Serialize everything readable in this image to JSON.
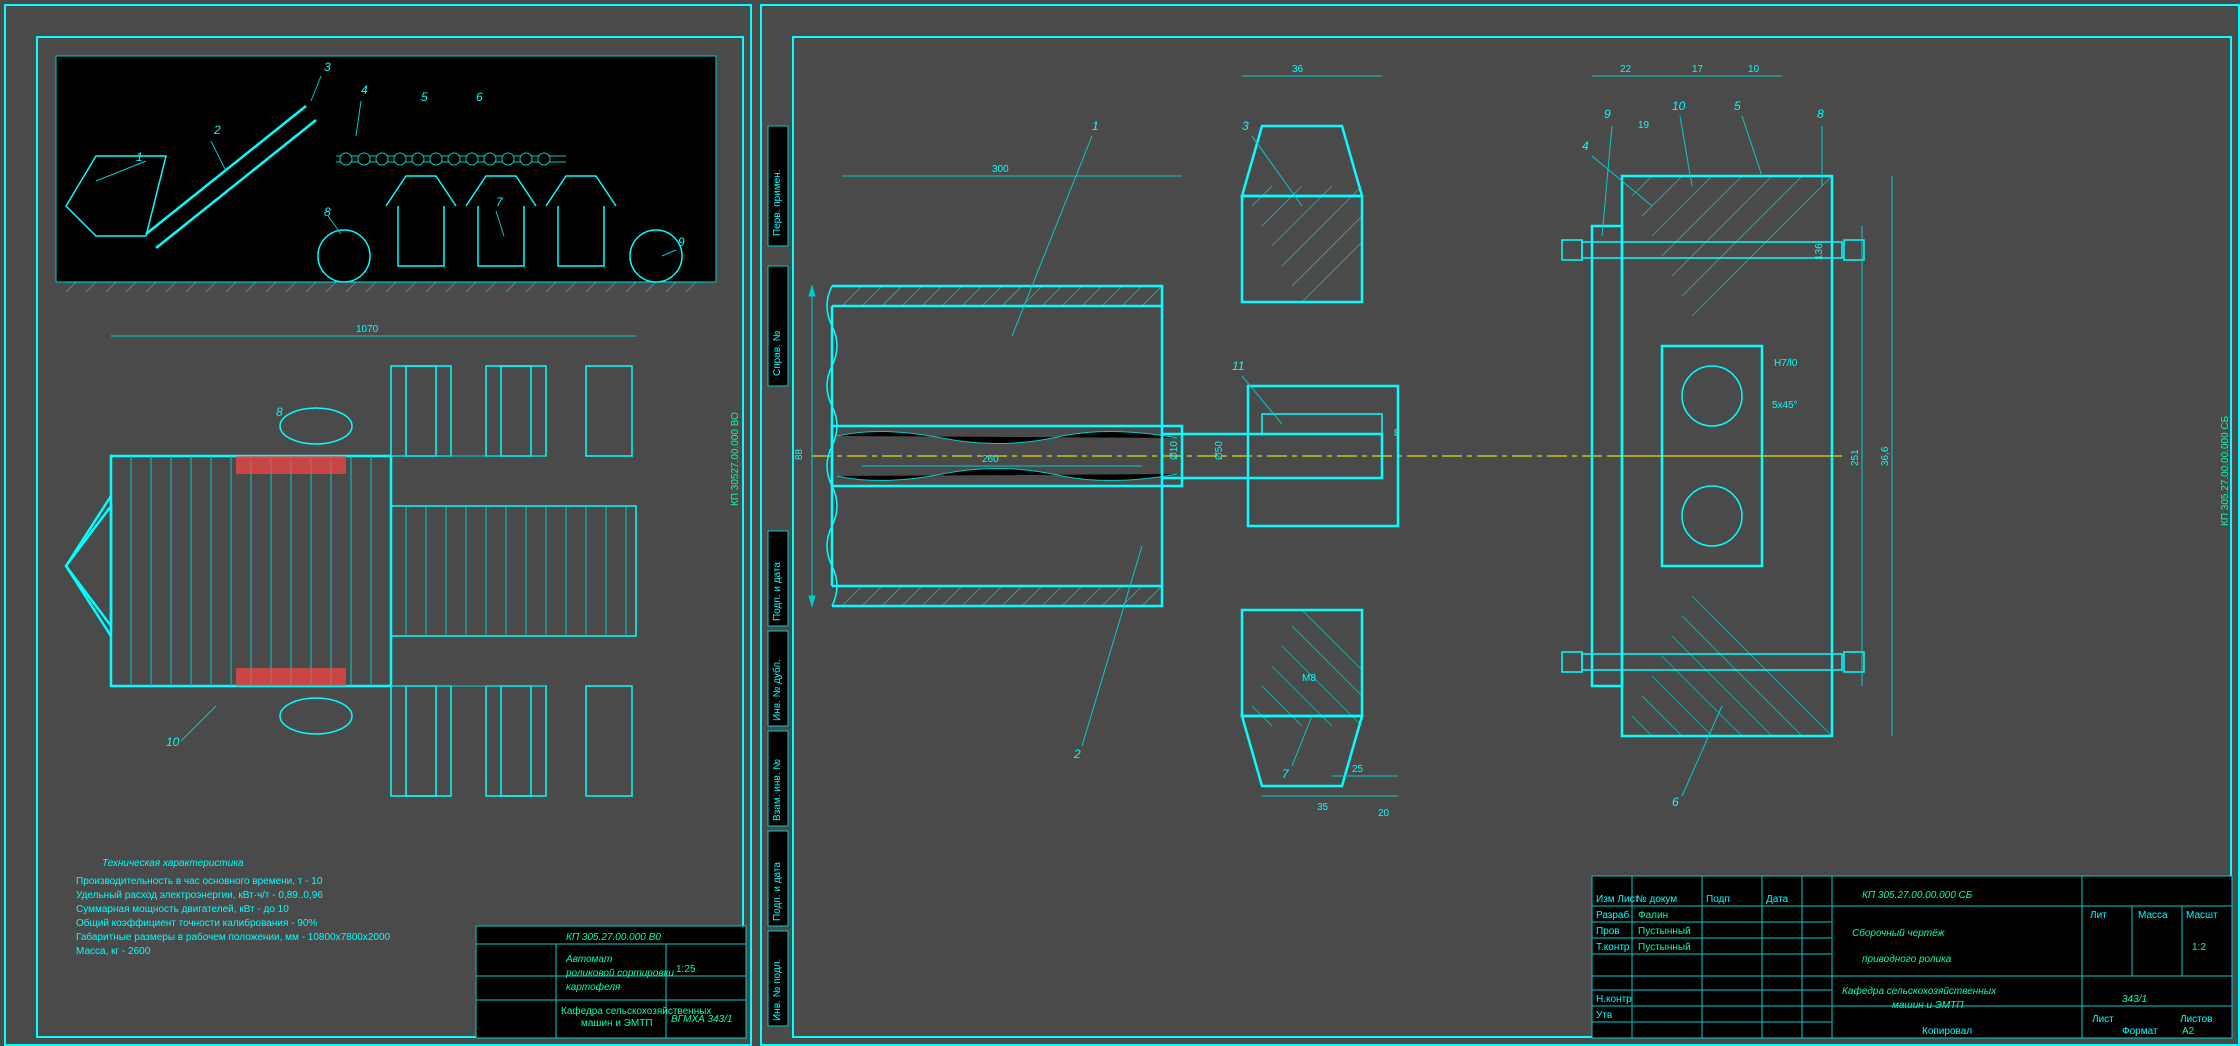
{
  "left": {
    "code": "КП 305.27.00.000 В0",
    "side_code": "КП 30527.00.000 ВО",
    "title_main": "Автомат",
    "title_sub1": "роликовой сортировки",
    "title_sub2": "картофеля",
    "university": "ВГМХА 343/1",
    "dept": "Кафедра сельскохозяйственных",
    "dept2": "машин и ЭМТП",
    "scale": "1:25",
    "tech": {
      "h": "Техническая характеристика",
      "l1": "Производительность в час основного времени, т - 10",
      "l2": "Удельный расход электроэнергии, кВт·ч/т - 0,89..0,96",
      "l3": "Суммарная мощность двигателей, кВт - до 10",
      "l4": "Общий коэффициент точности калибрования - 90%",
      "l5": "Габаритные размеры в рабочем положении, мм - 10800x7800x2000",
      "l6": "Масса, кг - 2600"
    },
    "parts": [
      "1",
      "2",
      "3",
      "4",
      "5",
      "6",
      "7",
      "8",
      "9",
      "10"
    ],
    "dims": {
      "top_len": "1070",
      "plan_len": "1070"
    }
  },
  "right": {
    "code": "КП 305.27.00.00.000 СБ",
    "side_code": "КП 305.27.00.00.000 СБ",
    "title1": "Сборочный чертёж",
    "title2": "приводного ролика",
    "dept": "Кафедра сельскохозяйственных",
    "dept2": "машин и ЭМТП",
    "group": "343/1",
    "scale": "1:2",
    "format": "А2",
    "parts": [
      "1",
      "2",
      "3",
      "4",
      "5",
      "6",
      "7",
      "8",
      "9",
      "10",
      "11"
    ],
    "dims": {
      "d_main": "88",
      "len1": "300",
      "len2": "260",
      "shaft_d": "Ø10",
      "hub_w": "36",
      "key_w": "M8",
      "hub_d": "Ø50",
      "key_f": "8",
      "small": "10",
      "gap25": "25",
      "gap35": "35",
      "gap20": "20",
      "flg22": "22",
      "flg17": "17",
      "flg10": "10",
      "btot": "36,6",
      "bseat": "251",
      "hbolt": "136",
      "ang": "5x45°",
      "fit": "H7/l0",
      "b9": "19"
    },
    "title_tbl": {
      "izm": "Изм Лист",
      "doc": "№ докум",
      "podp": "Подп",
      "data": "Дата",
      "razrab": "Разраб",
      "prov": "Пров",
      "tkontr": "Т.контр",
      "nkontr": "Н.контр",
      "utv": "Утв",
      "name1": "Фалин",
      "name2": "Пустынный",
      "name3": "Пустынный",
      "lit": "Лит",
      "massa": "Масса",
      "msht": "Масшт",
      "list": "Лист",
      "listov": "Листов",
      "kopir": "Копировал",
      "fmt": "Формат"
    },
    "side_tabs": [
      "Инв. № подл.",
      "Подп. и дата",
      "Взам. инв. №",
      "Инв. № дубл.",
      "Подп. и дата",
      "Справ. №",
      "Перв. примен."
    ]
  }
}
